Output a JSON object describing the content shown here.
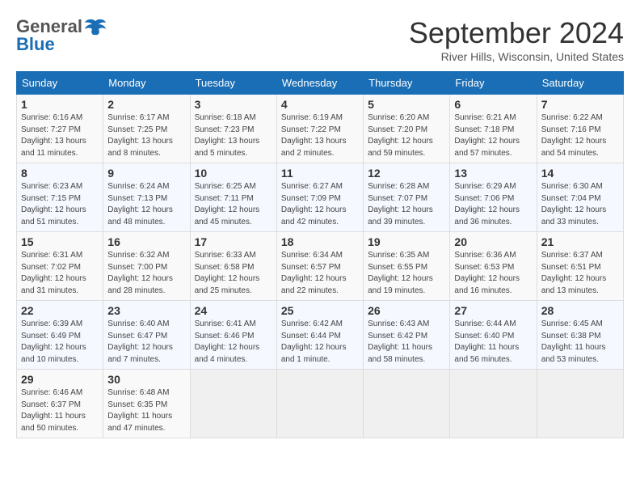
{
  "header": {
    "logo_general": "General",
    "logo_blue": "Blue",
    "month": "September 2024",
    "location": "River Hills, Wisconsin, United States"
  },
  "days_of_week": [
    "Sunday",
    "Monday",
    "Tuesday",
    "Wednesday",
    "Thursday",
    "Friday",
    "Saturday"
  ],
  "weeks": [
    [
      {
        "day": "1",
        "sunrise": "6:16 AM",
        "sunset": "7:27 PM",
        "daylight": "13 hours and 11 minutes."
      },
      {
        "day": "2",
        "sunrise": "6:17 AM",
        "sunset": "7:25 PM",
        "daylight": "13 hours and 8 minutes."
      },
      {
        "day": "3",
        "sunrise": "6:18 AM",
        "sunset": "7:23 PM",
        "daylight": "13 hours and 5 minutes."
      },
      {
        "day": "4",
        "sunrise": "6:19 AM",
        "sunset": "7:22 PM",
        "daylight": "13 hours and 2 minutes."
      },
      {
        "day": "5",
        "sunrise": "6:20 AM",
        "sunset": "7:20 PM",
        "daylight": "12 hours and 59 minutes."
      },
      {
        "day": "6",
        "sunrise": "6:21 AM",
        "sunset": "7:18 PM",
        "daylight": "12 hours and 57 minutes."
      },
      {
        "day": "7",
        "sunrise": "6:22 AM",
        "sunset": "7:16 PM",
        "daylight": "12 hours and 54 minutes."
      }
    ],
    [
      {
        "day": "8",
        "sunrise": "6:23 AM",
        "sunset": "7:15 PM",
        "daylight": "12 hours and 51 minutes."
      },
      {
        "day": "9",
        "sunrise": "6:24 AM",
        "sunset": "7:13 PM",
        "daylight": "12 hours and 48 minutes."
      },
      {
        "day": "10",
        "sunrise": "6:25 AM",
        "sunset": "7:11 PM",
        "daylight": "12 hours and 45 minutes."
      },
      {
        "day": "11",
        "sunrise": "6:27 AM",
        "sunset": "7:09 PM",
        "daylight": "12 hours and 42 minutes."
      },
      {
        "day": "12",
        "sunrise": "6:28 AM",
        "sunset": "7:07 PM",
        "daylight": "12 hours and 39 minutes."
      },
      {
        "day": "13",
        "sunrise": "6:29 AM",
        "sunset": "7:06 PM",
        "daylight": "12 hours and 36 minutes."
      },
      {
        "day": "14",
        "sunrise": "6:30 AM",
        "sunset": "7:04 PM",
        "daylight": "12 hours and 33 minutes."
      }
    ],
    [
      {
        "day": "15",
        "sunrise": "6:31 AM",
        "sunset": "7:02 PM",
        "daylight": "12 hours and 31 minutes."
      },
      {
        "day": "16",
        "sunrise": "6:32 AM",
        "sunset": "7:00 PM",
        "daylight": "12 hours and 28 minutes."
      },
      {
        "day": "17",
        "sunrise": "6:33 AM",
        "sunset": "6:58 PM",
        "daylight": "12 hours and 25 minutes."
      },
      {
        "day": "18",
        "sunrise": "6:34 AM",
        "sunset": "6:57 PM",
        "daylight": "12 hours and 22 minutes."
      },
      {
        "day": "19",
        "sunrise": "6:35 AM",
        "sunset": "6:55 PM",
        "daylight": "12 hours and 19 minutes."
      },
      {
        "day": "20",
        "sunrise": "6:36 AM",
        "sunset": "6:53 PM",
        "daylight": "12 hours and 16 minutes."
      },
      {
        "day": "21",
        "sunrise": "6:37 AM",
        "sunset": "6:51 PM",
        "daylight": "12 hours and 13 minutes."
      }
    ],
    [
      {
        "day": "22",
        "sunrise": "6:39 AM",
        "sunset": "6:49 PM",
        "daylight": "12 hours and 10 minutes."
      },
      {
        "day": "23",
        "sunrise": "6:40 AM",
        "sunset": "6:47 PM",
        "daylight": "12 hours and 7 minutes."
      },
      {
        "day": "24",
        "sunrise": "6:41 AM",
        "sunset": "6:46 PM",
        "daylight": "12 hours and 4 minutes."
      },
      {
        "day": "25",
        "sunrise": "6:42 AM",
        "sunset": "6:44 PM",
        "daylight": "12 hours and 1 minute."
      },
      {
        "day": "26",
        "sunrise": "6:43 AM",
        "sunset": "6:42 PM",
        "daylight": "11 hours and 58 minutes."
      },
      {
        "day": "27",
        "sunrise": "6:44 AM",
        "sunset": "6:40 PM",
        "daylight": "11 hours and 56 minutes."
      },
      {
        "day": "28",
        "sunrise": "6:45 AM",
        "sunset": "6:38 PM",
        "daylight": "11 hours and 53 minutes."
      }
    ],
    [
      {
        "day": "29",
        "sunrise": "6:46 AM",
        "sunset": "6:37 PM",
        "daylight": "11 hours and 50 minutes."
      },
      {
        "day": "30",
        "sunrise": "6:48 AM",
        "sunset": "6:35 PM",
        "daylight": "11 hours and 47 minutes."
      },
      null,
      null,
      null,
      null,
      null
    ]
  ],
  "labels": {
    "sunrise": "Sunrise:",
    "sunset": "Sunset:",
    "daylight": "Daylight:"
  }
}
